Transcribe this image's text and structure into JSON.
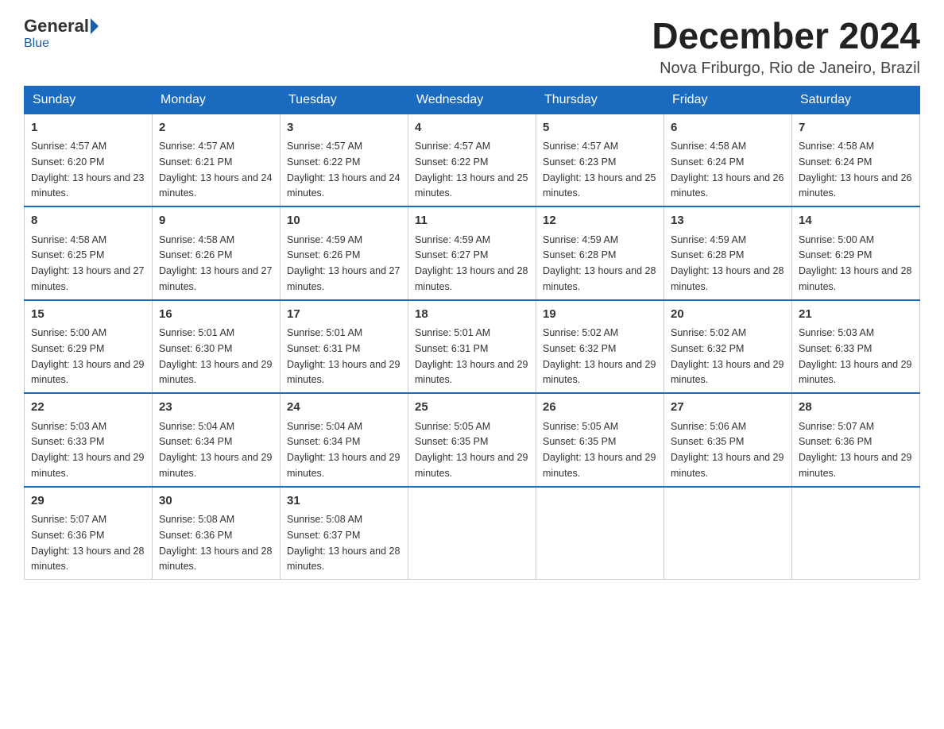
{
  "header": {
    "logo_general": "General",
    "logo_blue": "Blue",
    "title": "December 2024",
    "subtitle": "Nova Friburgo, Rio de Janeiro, Brazil"
  },
  "weekdays": [
    "Sunday",
    "Monday",
    "Tuesday",
    "Wednesday",
    "Thursday",
    "Friday",
    "Saturday"
  ],
  "weeks": [
    [
      {
        "day": "1",
        "sunrise": "4:57 AM",
        "sunset": "6:20 PM",
        "daylight": "13 hours and 23 minutes."
      },
      {
        "day": "2",
        "sunrise": "4:57 AM",
        "sunset": "6:21 PM",
        "daylight": "13 hours and 24 minutes."
      },
      {
        "day": "3",
        "sunrise": "4:57 AM",
        "sunset": "6:22 PM",
        "daylight": "13 hours and 24 minutes."
      },
      {
        "day": "4",
        "sunrise": "4:57 AM",
        "sunset": "6:22 PM",
        "daylight": "13 hours and 25 minutes."
      },
      {
        "day": "5",
        "sunrise": "4:57 AM",
        "sunset": "6:23 PM",
        "daylight": "13 hours and 25 minutes."
      },
      {
        "day": "6",
        "sunrise": "4:58 AM",
        "sunset": "6:24 PM",
        "daylight": "13 hours and 26 minutes."
      },
      {
        "day": "7",
        "sunrise": "4:58 AM",
        "sunset": "6:24 PM",
        "daylight": "13 hours and 26 minutes."
      }
    ],
    [
      {
        "day": "8",
        "sunrise": "4:58 AM",
        "sunset": "6:25 PM",
        "daylight": "13 hours and 27 minutes."
      },
      {
        "day": "9",
        "sunrise": "4:58 AM",
        "sunset": "6:26 PM",
        "daylight": "13 hours and 27 minutes."
      },
      {
        "day": "10",
        "sunrise": "4:59 AM",
        "sunset": "6:26 PM",
        "daylight": "13 hours and 27 minutes."
      },
      {
        "day": "11",
        "sunrise": "4:59 AM",
        "sunset": "6:27 PM",
        "daylight": "13 hours and 28 minutes."
      },
      {
        "day": "12",
        "sunrise": "4:59 AM",
        "sunset": "6:28 PM",
        "daylight": "13 hours and 28 minutes."
      },
      {
        "day": "13",
        "sunrise": "4:59 AM",
        "sunset": "6:28 PM",
        "daylight": "13 hours and 28 minutes."
      },
      {
        "day": "14",
        "sunrise": "5:00 AM",
        "sunset": "6:29 PM",
        "daylight": "13 hours and 28 minutes."
      }
    ],
    [
      {
        "day": "15",
        "sunrise": "5:00 AM",
        "sunset": "6:29 PM",
        "daylight": "13 hours and 29 minutes."
      },
      {
        "day": "16",
        "sunrise": "5:01 AM",
        "sunset": "6:30 PM",
        "daylight": "13 hours and 29 minutes."
      },
      {
        "day": "17",
        "sunrise": "5:01 AM",
        "sunset": "6:31 PM",
        "daylight": "13 hours and 29 minutes."
      },
      {
        "day": "18",
        "sunrise": "5:01 AM",
        "sunset": "6:31 PM",
        "daylight": "13 hours and 29 minutes."
      },
      {
        "day": "19",
        "sunrise": "5:02 AM",
        "sunset": "6:32 PM",
        "daylight": "13 hours and 29 minutes."
      },
      {
        "day": "20",
        "sunrise": "5:02 AM",
        "sunset": "6:32 PM",
        "daylight": "13 hours and 29 minutes."
      },
      {
        "day": "21",
        "sunrise": "5:03 AM",
        "sunset": "6:33 PM",
        "daylight": "13 hours and 29 minutes."
      }
    ],
    [
      {
        "day": "22",
        "sunrise": "5:03 AM",
        "sunset": "6:33 PM",
        "daylight": "13 hours and 29 minutes."
      },
      {
        "day": "23",
        "sunrise": "5:04 AM",
        "sunset": "6:34 PM",
        "daylight": "13 hours and 29 minutes."
      },
      {
        "day": "24",
        "sunrise": "5:04 AM",
        "sunset": "6:34 PM",
        "daylight": "13 hours and 29 minutes."
      },
      {
        "day": "25",
        "sunrise": "5:05 AM",
        "sunset": "6:35 PM",
        "daylight": "13 hours and 29 minutes."
      },
      {
        "day": "26",
        "sunrise": "5:05 AM",
        "sunset": "6:35 PM",
        "daylight": "13 hours and 29 minutes."
      },
      {
        "day": "27",
        "sunrise": "5:06 AM",
        "sunset": "6:35 PM",
        "daylight": "13 hours and 29 minutes."
      },
      {
        "day": "28",
        "sunrise": "5:07 AM",
        "sunset": "6:36 PM",
        "daylight": "13 hours and 29 minutes."
      }
    ],
    [
      {
        "day": "29",
        "sunrise": "5:07 AM",
        "sunset": "6:36 PM",
        "daylight": "13 hours and 28 minutes."
      },
      {
        "day": "30",
        "sunrise": "5:08 AM",
        "sunset": "6:36 PM",
        "daylight": "13 hours and 28 minutes."
      },
      {
        "day": "31",
        "sunrise": "5:08 AM",
        "sunset": "6:37 PM",
        "daylight": "13 hours and 28 minutes."
      },
      null,
      null,
      null,
      null
    ]
  ]
}
